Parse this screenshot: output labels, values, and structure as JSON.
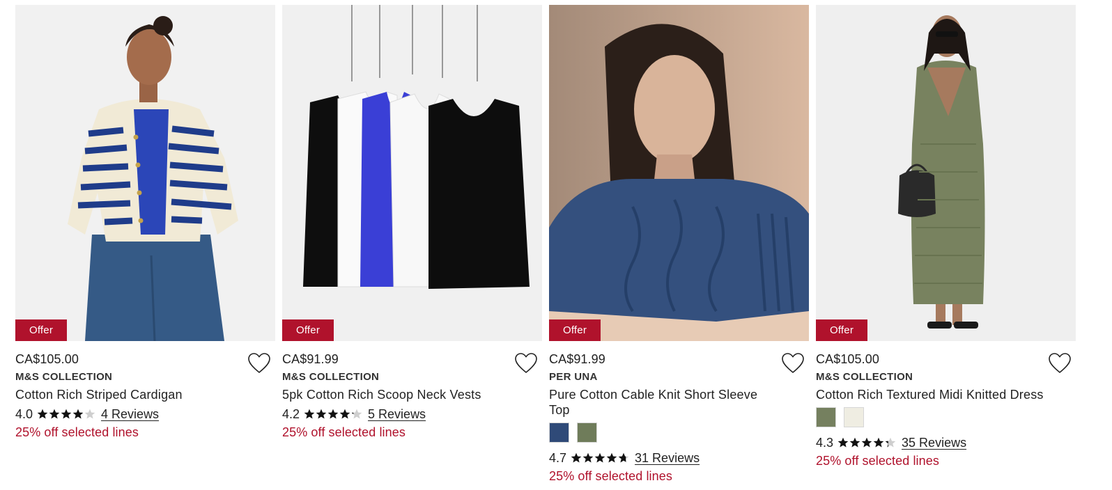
{
  "colors": {
    "offer_bg": "#b0122c",
    "promo_text": "#b0122c",
    "star": "#111111",
    "star_empty": "#cfcfcf"
  },
  "products": [
    {
      "badge": "Offer",
      "price": "CA$105.00",
      "brand": "M&S COLLECTION",
      "title": "Cotton Rich Striped Cardigan",
      "rating": "4.0",
      "rating_value": 4.0,
      "reviews": "4 Reviews",
      "promo": "25% off selected lines",
      "swatches": [],
      "image": "model-striped-cardigan"
    },
    {
      "badge": "Offer",
      "price": "CA$91.99",
      "brand": "M&S COLLECTION",
      "title": "5pk Cotton Rich Scoop Neck Vests",
      "rating": "4.2",
      "rating_value": 4.2,
      "reviews": "5 Reviews",
      "promo": "25% off selected lines",
      "swatches": [],
      "image": "hanging-vests"
    },
    {
      "badge": "Offer",
      "price": "CA$91.99",
      "brand": "PER UNA",
      "title": "Pure Cotton Cable Knit Short Sleeve Top",
      "rating": "4.7",
      "rating_value": 4.7,
      "reviews": "31 Reviews",
      "promo": "25% off selected lines",
      "swatches": [
        "#2f4a78",
        "#6f7c5a"
      ],
      "image": "model-cable-knit"
    },
    {
      "badge": "Offer",
      "price": "CA$105.00",
      "brand": "M&S COLLECTION",
      "title": "Cotton Rich Textured Midi Knitted Dress",
      "rating": "4.3",
      "rating_value": 4.3,
      "reviews": "35 Reviews",
      "promo": "25% off selected lines",
      "swatches": [
        "#75805f",
        "#efede2"
      ],
      "image": "model-midi-dress"
    }
  ]
}
